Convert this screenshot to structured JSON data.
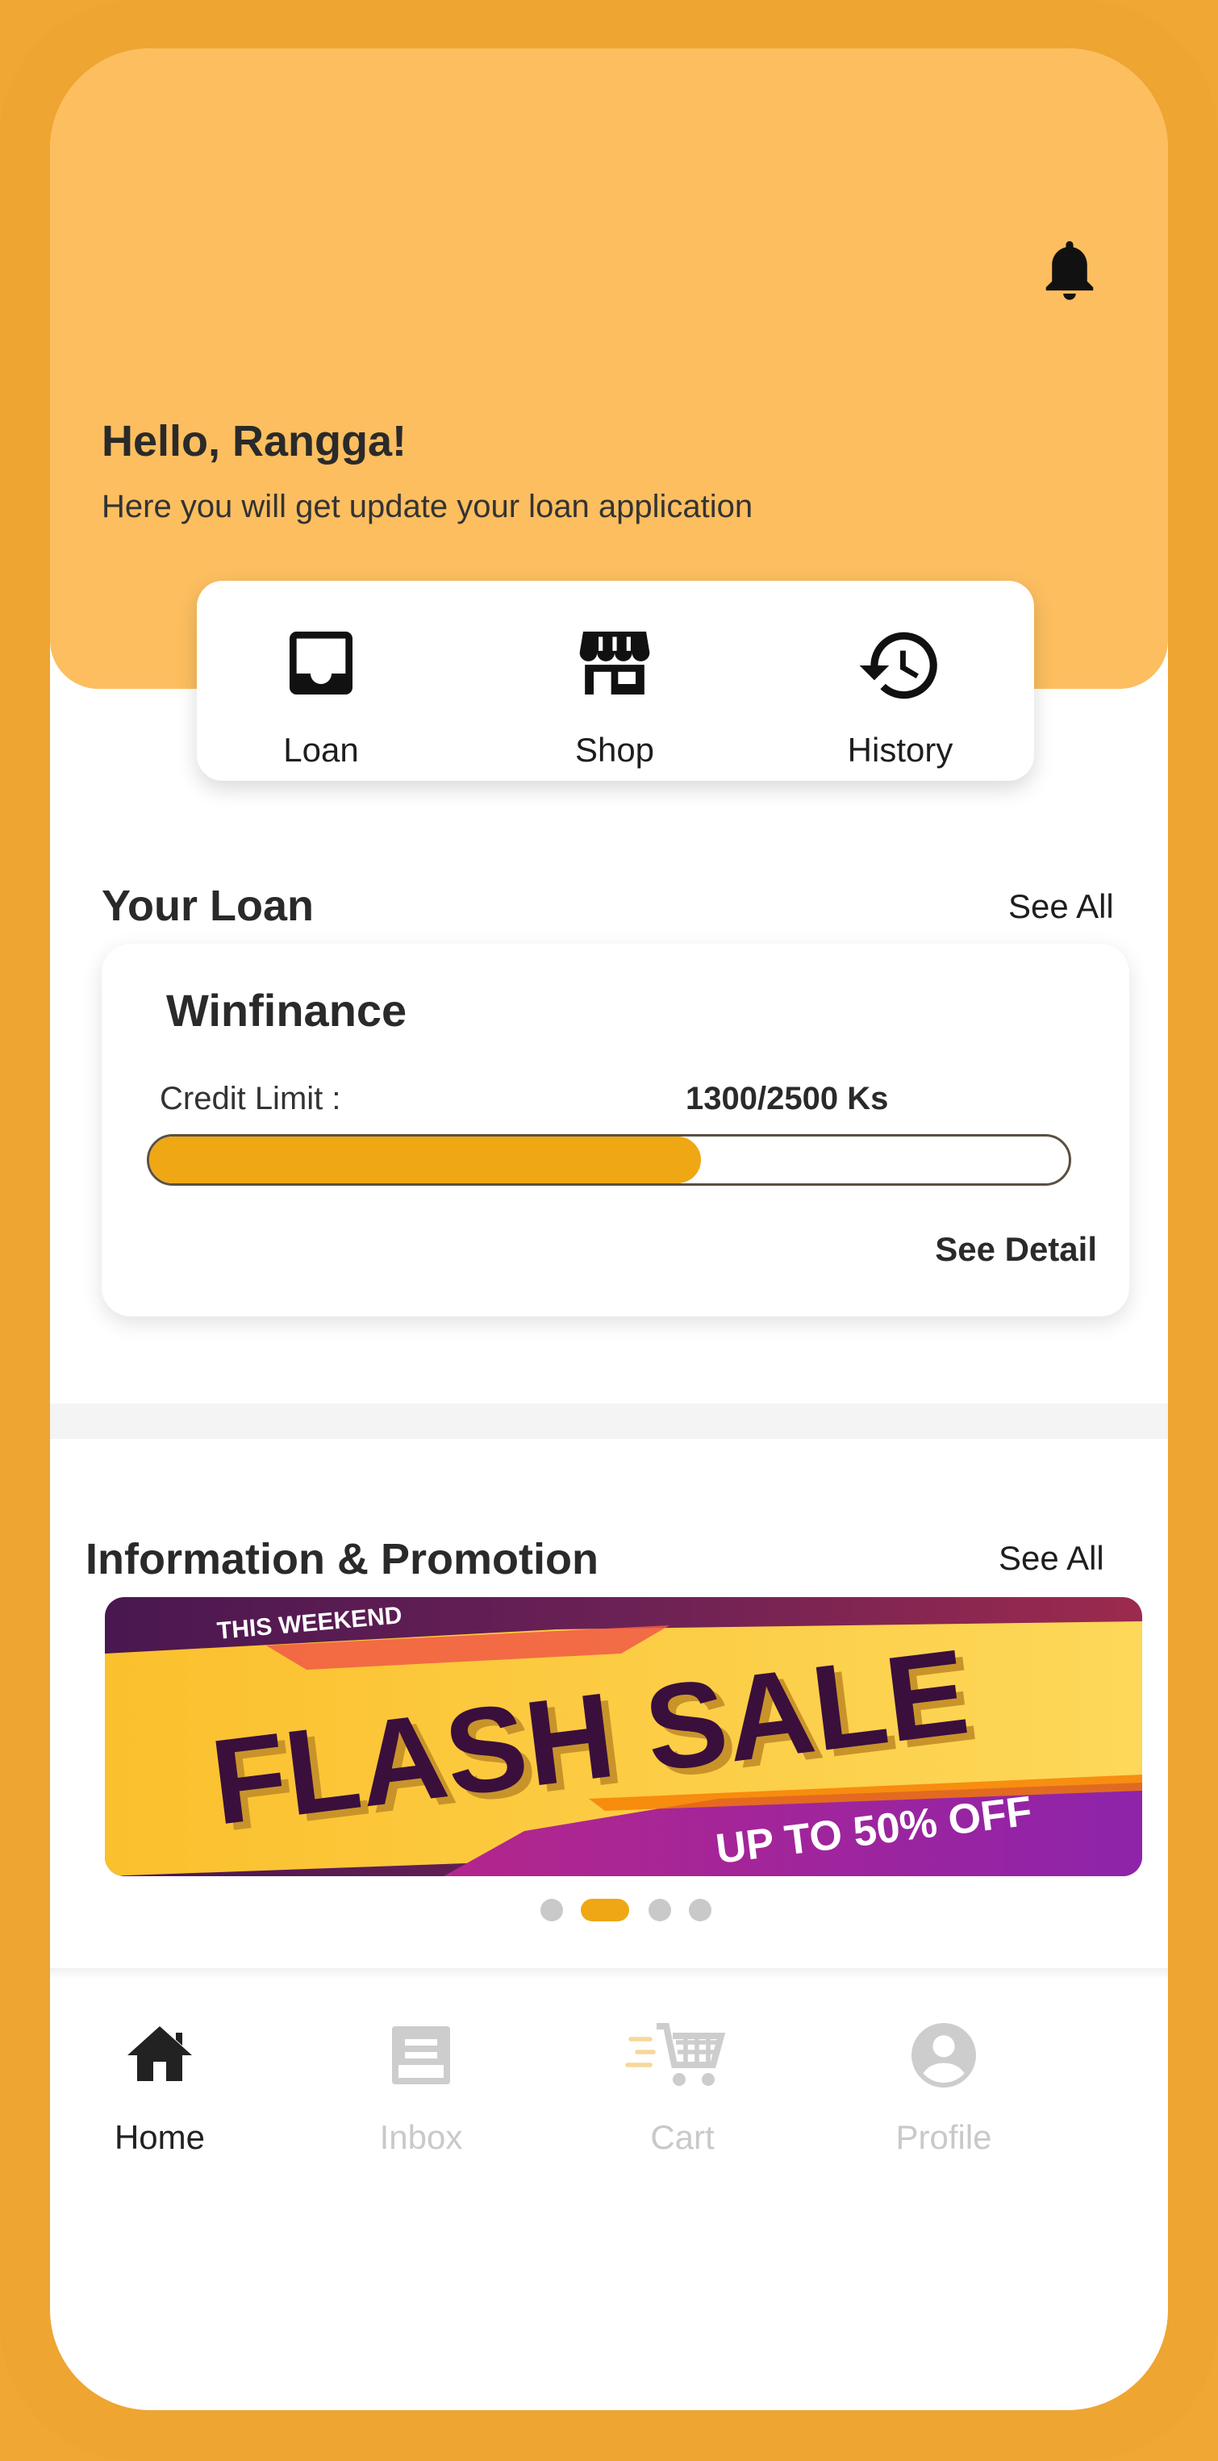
{
  "header": {
    "greeting": "Hello, Rangga!",
    "subtitle": "Here you will get update your loan application"
  },
  "quick_actions": [
    {
      "label": "Loan",
      "icon": "inbox-tray-icon"
    },
    {
      "label": "Shop",
      "icon": "storefront-icon"
    },
    {
      "label": "History",
      "icon": "history-clock-icon"
    }
  ],
  "your_loan": {
    "title": "Your Loan",
    "see_all": "See All",
    "card": {
      "name": "Winfinance",
      "credit_label": "Credit Limit :",
      "credit_value": "1300/2500 Ks",
      "progress_fraction": 0.6,
      "see_detail": "See Detail"
    }
  },
  "promotions": {
    "title": "Information & Promotion",
    "see_all": "See All",
    "banner": {
      "top_text": "THIS WEEKEND",
      "headline": "FLASH SALE",
      "subline": "UP TO 50% OFF"
    },
    "dot_count": 4,
    "active_dot": 1
  },
  "bottom_nav": [
    {
      "label": "Home",
      "icon": "home-icon",
      "active": true
    },
    {
      "label": "Inbox",
      "icon": "inbox-icon",
      "active": false
    },
    {
      "label": "Cart",
      "icon": "cart-icon",
      "active": false
    },
    {
      "label": "Profile",
      "icon": "profile-icon",
      "active": false
    }
  ],
  "colors": {
    "frame": "#EEA531",
    "header": "#FCBE5F",
    "accent": "#F0A714",
    "banner_purple": "#4A1750",
    "banner_yellow": "#FBC02D"
  }
}
